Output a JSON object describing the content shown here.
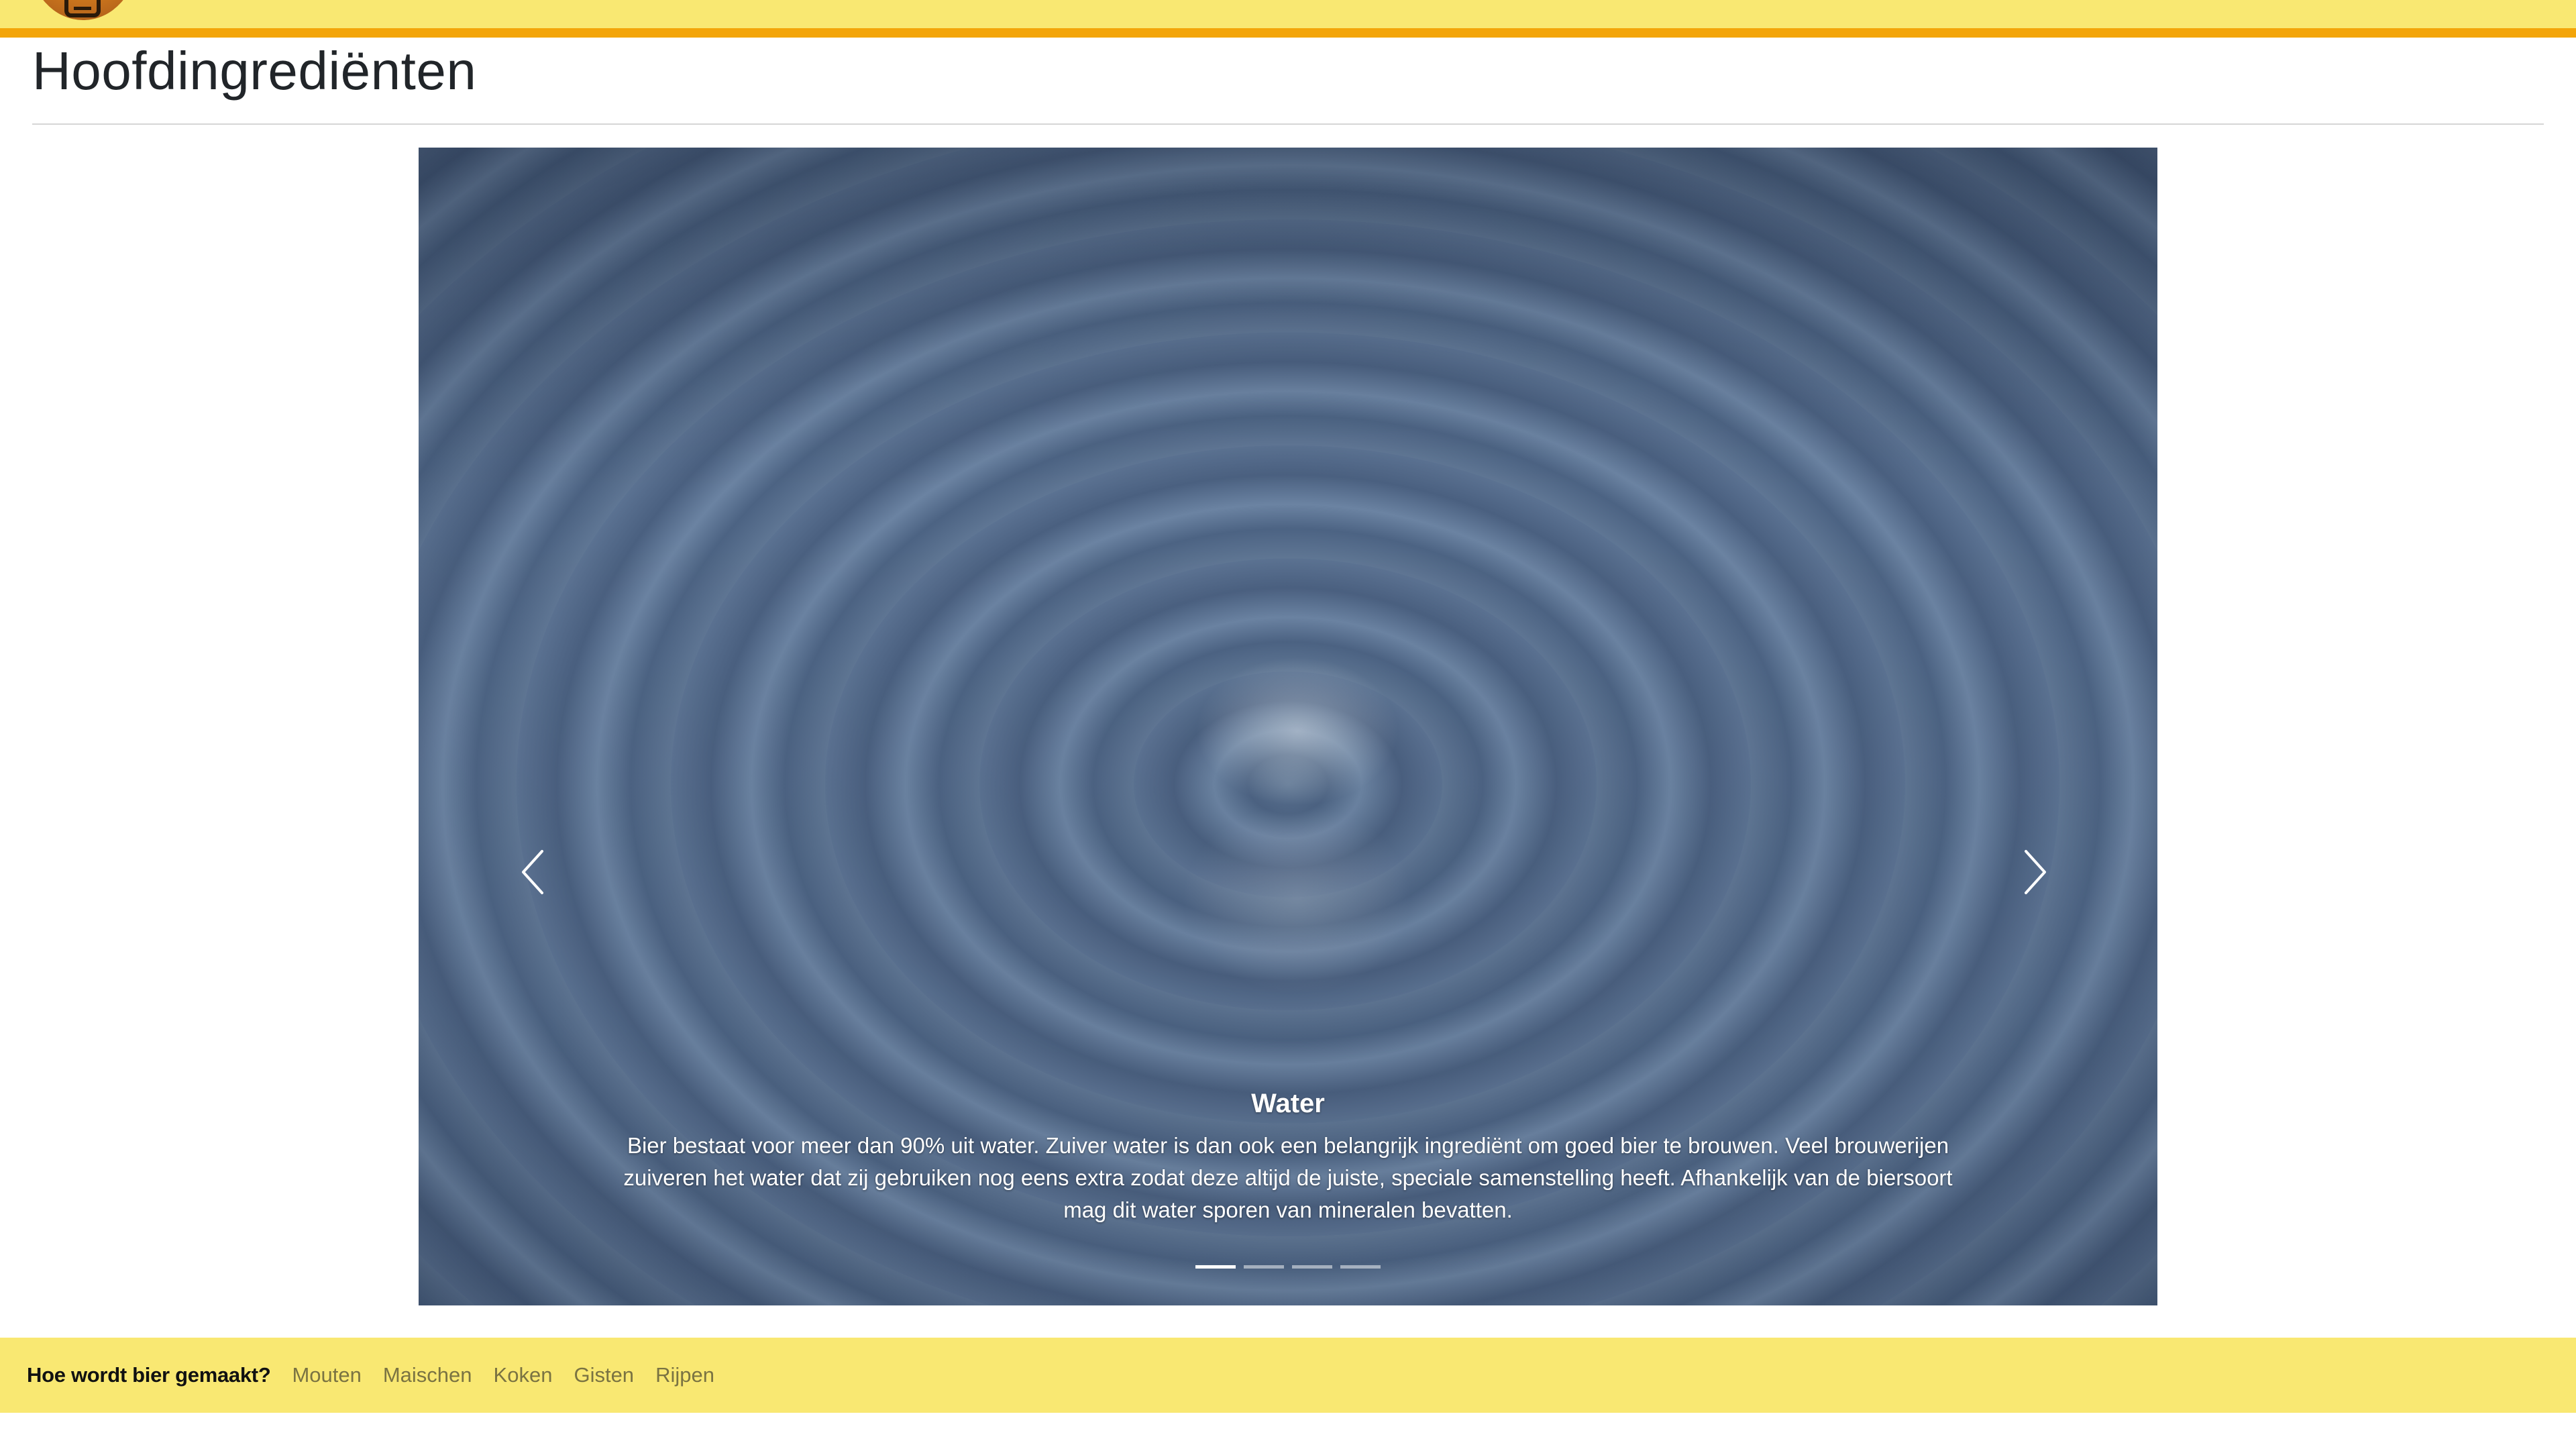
{
  "header": {
    "brand_color": "#f9e872",
    "accent_stripe_color": "#f3a50a",
    "logo_icon": "beer-mug-logo"
  },
  "page": {
    "title": "Hoofdingrediënten"
  },
  "carousel": {
    "active_index": 0,
    "slides_count": 4,
    "slide": {
      "image": "water-droplet-ripple-photo",
      "title": "Water",
      "text": "Bier bestaat voor meer dan 90% uit water. Zuiver water is dan ook een belangrijk ingrediënt om goed bier te brouwen. Veel brouwerijen zuiveren het water dat zij gebruiken nog eens extra zodat deze altijd de juiste, speciale samenstelling heeft. Afhankelijk van de biersoort mag dit water sporen van mineralen bevatten."
    },
    "prev_icon": "chevron-left-icon",
    "next_icon": "chevron-right-icon"
  },
  "footer_nav": {
    "brand": "Hoe wordt bier gemaakt?",
    "links": [
      "Mouten",
      "Maischen",
      "Koken",
      "Gisten",
      "Rijpen"
    ]
  }
}
